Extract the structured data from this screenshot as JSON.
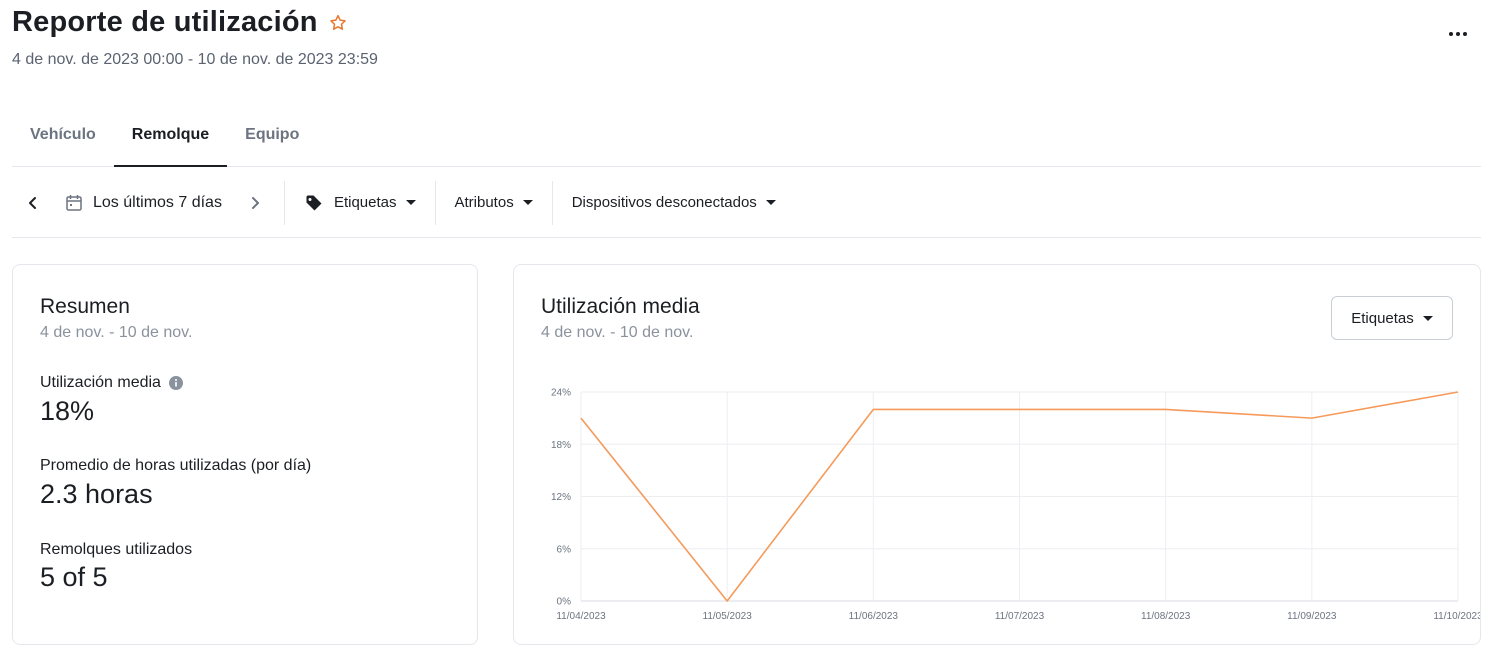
{
  "header": {
    "title": "Reporte de utilización",
    "subtitle": "4 de nov. de 2023 00:00 - 10 de nov. de 2023 23:59",
    "star_icon": "star-outline-icon",
    "more_icon": "more-horizontal-icon",
    "accent_color": "#e8772e"
  },
  "tabs": [
    {
      "label": "Vehículo",
      "active": false
    },
    {
      "label": "Remolque",
      "active": true
    },
    {
      "label": "Equipo",
      "active": false
    }
  ],
  "filters": {
    "date_range": "Los últimos 7 días",
    "tags": "Etiquetas",
    "attributes": "Atributos",
    "disconnected": "Dispositivos desconectados"
  },
  "summary": {
    "title": "Resumen",
    "range": "4 de nov. - 10 de nov.",
    "metrics": [
      {
        "label": "Utilización media",
        "value": "18%"
      },
      {
        "label": "Promedio de horas utilizadas (por día)",
        "value": "2.3 horas"
      },
      {
        "label": "Remolques utilizados",
        "value": "5 of 5"
      }
    ]
  },
  "chart_card": {
    "title": "Utilización media",
    "range": "4 de nov. - 10 de nov.",
    "group_by": "Etiquetas"
  },
  "chart_data": {
    "type": "line",
    "x": [
      "11/04/2023",
      "11/05/2023",
      "11/06/2023",
      "11/07/2023",
      "11/08/2023",
      "11/09/2023",
      "11/10/2023"
    ],
    "series": [
      {
        "values": [
          21,
          0,
          22,
          22,
          22,
          21,
          24
        ],
        "color": "#f59a5b"
      }
    ],
    "yticks": [
      "0%",
      "6%",
      "12%",
      "18%",
      "24%"
    ],
    "ylim": [
      0,
      24
    ],
    "grid": true,
    "legend": "none"
  }
}
